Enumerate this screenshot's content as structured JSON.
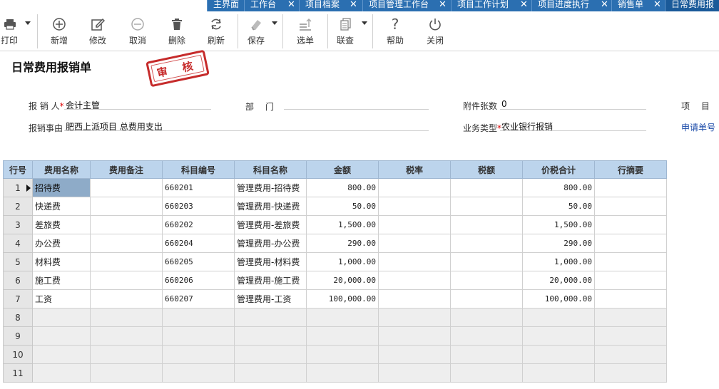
{
  "tabs": [
    {
      "label": "主界面",
      "closable": false
    },
    {
      "label": "工作台",
      "closable": true
    },
    {
      "label": "项目档案",
      "closable": true
    },
    {
      "label": "项目管理工作台",
      "closable": true
    },
    {
      "label": "项目工作计划",
      "closable": true
    },
    {
      "label": "项目进度执行",
      "closable": true
    },
    {
      "label": "销售单",
      "closable": true
    },
    {
      "label": "日常费用报",
      "closable": false,
      "active": true
    }
  ],
  "toolbar": {
    "print": "打印",
    "add": "新增",
    "edit": "修改",
    "cancel": "取消",
    "delete": "删除",
    "refresh": "刷新",
    "save": "保存",
    "select": "选单",
    "linked": "联查",
    "help": "帮助",
    "close": "关闭"
  },
  "form": {
    "title": "日常费用报销单",
    "stamp": "审 核",
    "reporter_label": "报 销 人",
    "reporter_value": "会计主管",
    "dept_label": "部　 门",
    "dept_value": "",
    "attachments_label": "附件张数",
    "attachments_value": "0",
    "project_label": "项　 目",
    "reason_label": "报销事由",
    "reason_value": "肥西上派项目 总费用支出",
    "biz_type_label": "业务类型",
    "biz_type_value": "农业银行报销",
    "apply_no_label": "申请单号"
  },
  "grid": {
    "headers": [
      "行号",
      "费用名称",
      "费用备注",
      "科目编号",
      "科目名称",
      "金额",
      "税率",
      "税额",
      "价税合计",
      "行摘要"
    ],
    "rows": [
      {
        "no": "1",
        "name": "招待费",
        "note": "",
        "code": "660201",
        "subject": "管理费用-招待费",
        "amount": "800.00",
        "tax_rate": "",
        "tax": "",
        "total": "800.00",
        "summary": ""
      },
      {
        "no": "2",
        "name": "快递费",
        "note": "",
        "code": "660203",
        "subject": "管理费用-快递费",
        "amount": "50.00",
        "tax_rate": "",
        "tax": "",
        "total": "50.00",
        "summary": ""
      },
      {
        "no": "3",
        "name": "差旅费",
        "note": "",
        "code": "660202",
        "subject": "管理费用-差旅费",
        "amount": "1,500.00",
        "tax_rate": "",
        "tax": "",
        "total": "1,500.00",
        "summary": ""
      },
      {
        "no": "4",
        "name": "办公费",
        "note": "",
        "code": "660204",
        "subject": "管理费用-办公费",
        "amount": "290.00",
        "tax_rate": "",
        "tax": "",
        "total": "290.00",
        "summary": ""
      },
      {
        "no": "5",
        "name": "材料费",
        "note": "",
        "code": "660205",
        "subject": "管理费用-材料费",
        "amount": "1,000.00",
        "tax_rate": "",
        "tax": "",
        "total": "1,000.00",
        "summary": ""
      },
      {
        "no": "6",
        "name": "施工费",
        "note": "",
        "code": "660206",
        "subject": "管理费用-施工费",
        "amount": "20,000.00",
        "tax_rate": "",
        "tax": "",
        "total": "20,000.00",
        "summary": ""
      },
      {
        "no": "7",
        "name": "工资",
        "note": "",
        "code": "660207",
        "subject": "管理费用-工资",
        "amount": "100,000.00",
        "tax_rate": "",
        "tax": "",
        "total": "100,000.00",
        "summary": ""
      },
      {
        "no": "8",
        "name": "",
        "note": "",
        "code": "",
        "subject": "",
        "amount": "",
        "tax_rate": "",
        "tax": "",
        "total": "",
        "summary": ""
      },
      {
        "no": "9",
        "name": "",
        "note": "",
        "code": "",
        "subject": "",
        "amount": "",
        "tax_rate": "",
        "tax": "",
        "total": "",
        "summary": ""
      },
      {
        "no": "10",
        "name": "",
        "note": "",
        "code": "",
        "subject": "",
        "amount": "",
        "tax_rate": "",
        "tax": "",
        "total": "",
        "summary": ""
      },
      {
        "no": "11",
        "name": "",
        "note": "",
        "code": "",
        "subject": "",
        "amount": "",
        "tax_rate": "",
        "tax": "",
        "total": "",
        "summary": ""
      }
    ]
  },
  "colors": {
    "tab_bar": "#2b6fb1",
    "grid_header": "#bcd4ec",
    "selected_cell": "#8eabc8",
    "stamp": "#c62b2b",
    "link": "#1a4aa8"
  }
}
